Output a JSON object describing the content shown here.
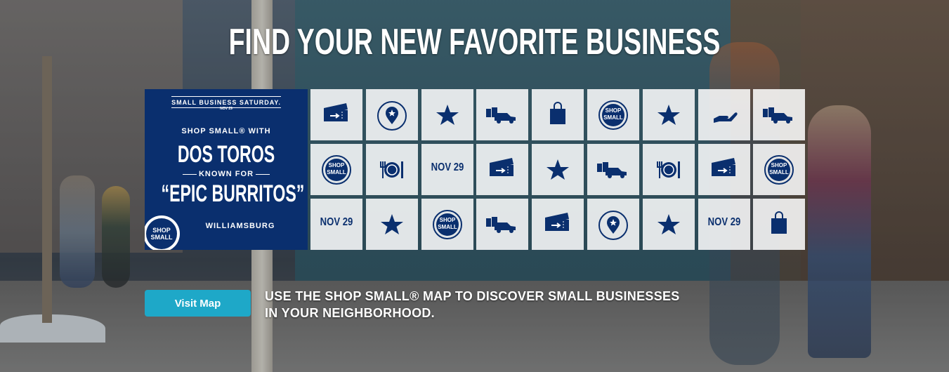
{
  "hero": {
    "headline": "FIND YOUR NEW FAVORITE BUSINESS",
    "tagline_line1": "USE THE SHOP SMALL® MAP TO DISCOVER SMALL BUSINESSES",
    "tagline_line2": "IN YOUR NEIGHBORHOOD.",
    "visit_button_label": "Visit Map"
  },
  "card": {
    "event_label": "SMALL BUSINESS SATURDAY.",
    "event_date": "NOV 29",
    "shop_line": "SHOP SMALL® WITH",
    "business_name": "DOS TOROS",
    "known_for_label": "KNOWN FOR",
    "favorite": "“EPIC BURRITOS”",
    "location": "WILLIAMSBURG",
    "badge_line1": "SHOP",
    "badge_line2": "SMALL"
  },
  "tiles": {
    "nov_text": "NOV 29",
    "shop_text1": "SHOP",
    "shop_text2": "SMALL",
    "rows": [
      [
        "ticket-icon",
        "map-pin-icon",
        "star-icon",
        "luggage-car-icon",
        "shopping-bag-icon",
        "shop-small-icon",
        "star-icon",
        "hand-icon",
        "luggage-car-icon"
      ],
      [
        "shop-small-icon",
        "dining-icon",
        "nov29",
        "ticket-icon",
        "star-icon",
        "luggage-car-icon",
        "dining-icon",
        "ticket-icon",
        "shop-small-icon"
      ],
      [
        "nov29",
        "star-icon",
        "shop-small-icon",
        "luggage-car-icon",
        "ticket-icon",
        "map-pin-icon",
        "star-icon",
        "nov29",
        "shopping-bag-icon"
      ]
    ]
  },
  "colors": {
    "navy": "#0a2f6e",
    "button": "#1ea8c8",
    "tile": "#ffffff"
  }
}
